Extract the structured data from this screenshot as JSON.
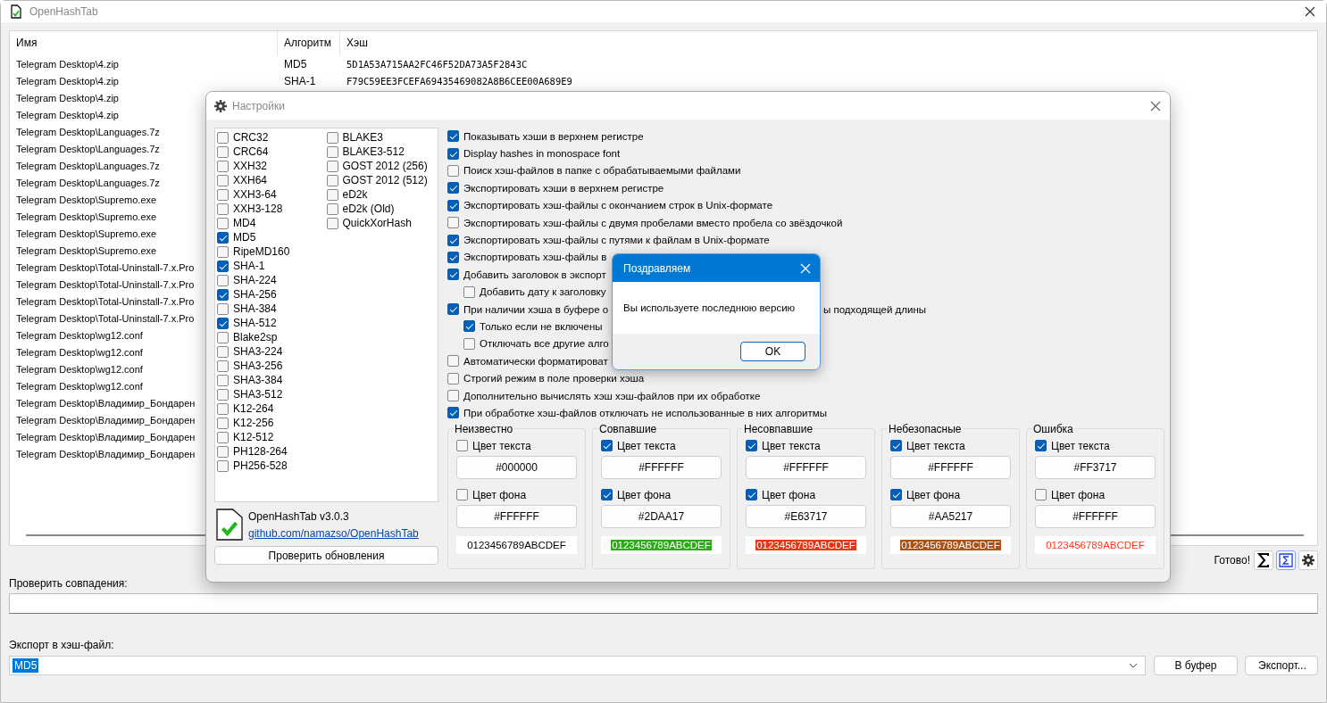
{
  "window": {
    "title": "OpenHashTab"
  },
  "table": {
    "columns": [
      "Имя",
      "Алгоритм",
      "Хэш"
    ],
    "rows": [
      {
        "name": "Telegram Desktop\\4.zip",
        "algorithm": "MD5",
        "hash": "5D1A53A715AA2FC46F52DA73A5F2843C"
      },
      {
        "name": "Telegram Desktop\\4.zip",
        "algorithm": "SHA-1",
        "hash": "F79C59EE3FCEFA69435469082A8B6CEE00A689E9"
      },
      {
        "name": "Telegram Desktop\\4.zip"
      },
      {
        "name": "Telegram Desktop\\4.zip"
      },
      {
        "name": "Telegram Desktop\\Languages.7z"
      },
      {
        "name": "Telegram Desktop\\Languages.7z"
      },
      {
        "name": "Telegram Desktop\\Languages.7z"
      },
      {
        "name": "Telegram Desktop\\Languages.7z"
      },
      {
        "name": "Telegram Desktop\\Supremo.exe"
      },
      {
        "name": "Telegram Desktop\\Supremo.exe"
      },
      {
        "name": "Telegram Desktop\\Supremo.exe"
      },
      {
        "name": "Telegram Desktop\\Supremo.exe"
      },
      {
        "name": "Telegram Desktop\\Total-Uninstall-7.x.Pro"
      },
      {
        "name": "Telegram Desktop\\Total-Uninstall-7.x.Pro"
      },
      {
        "name": "Telegram Desktop\\Total-Uninstall-7.x.Pro"
      },
      {
        "name": "Telegram Desktop\\Total-Uninstall-7.x.Pro"
      },
      {
        "name": "Telegram Desktop\\wg12.conf"
      },
      {
        "name": "Telegram Desktop\\wg12.conf"
      },
      {
        "name": "Telegram Desktop\\wg12.conf"
      },
      {
        "name": "Telegram Desktop\\wg12.conf"
      },
      {
        "name": "Telegram Desktop\\Владимир_Бондарен"
      },
      {
        "name": "Telegram Desktop\\Владимир_Бондарен"
      },
      {
        "name": "Telegram Desktop\\Владимир_Бондарен"
      },
      {
        "name": "Telegram Desktop\\Владимир_Бондарен"
      }
    ]
  },
  "status": "Готово!",
  "verify": {
    "label": "Проверить совпадения:"
  },
  "export": {
    "label": "Экспорт в хэш-файл:",
    "value": "MD5",
    "buttons": [
      "В буфер",
      "Экспорт..."
    ]
  },
  "settings": {
    "title": "Настройки",
    "algorithm_columns": [
      [
        {
          "label": "CRC32",
          "checked": false
        },
        {
          "label": "CRC64",
          "checked": false
        },
        {
          "label": "XXH32",
          "checked": false
        },
        {
          "label": "XXH64",
          "checked": false
        },
        {
          "label": "XXH3-64",
          "checked": false
        },
        {
          "label": "XXH3-128",
          "checked": false
        },
        {
          "label": "MD4",
          "checked": false
        },
        {
          "label": "MD5",
          "checked": true
        },
        {
          "label": "RipeMD160",
          "checked": false
        },
        {
          "label": "SHA-1",
          "checked": true
        },
        {
          "label": "SHA-224",
          "checked": false
        },
        {
          "label": "SHA-256",
          "checked": true
        },
        {
          "label": "SHA-384",
          "checked": false
        },
        {
          "label": "SHA-512",
          "checked": true
        },
        {
          "label": "Blake2sp",
          "checked": false
        },
        {
          "label": "SHA3-224",
          "checked": false
        },
        {
          "label": "SHA3-256",
          "checked": false
        },
        {
          "label": "SHA3-384",
          "checked": false
        },
        {
          "label": "SHA3-512",
          "checked": false
        },
        {
          "label": "K12-264",
          "checked": false
        },
        {
          "label": "K12-256",
          "checked": false
        },
        {
          "label": "K12-512",
          "checked": false
        },
        {
          "label": "PH128-264",
          "checked": false
        },
        {
          "label": "PH256-528",
          "checked": false
        }
      ],
      [
        {
          "label": "BLAKE3",
          "checked": false
        },
        {
          "label": "BLAKE3-512",
          "checked": false
        },
        {
          "label": "GOST 2012 (256)",
          "checked": false
        },
        {
          "label": "GOST 2012 (512)",
          "checked": false
        },
        {
          "label": "eD2k",
          "checked": false
        },
        {
          "label": "eD2k (Old)",
          "checked": false
        },
        {
          "label": "QuickXorHash",
          "checked": false
        }
      ]
    ],
    "about": {
      "name": "OpenHashTab v3.0.3",
      "link": "github.com/namazso/OpenHashTab"
    },
    "update_button": "Проверить обновления",
    "options": [
      {
        "label": "Показывать хэши в верхнем регистре",
        "checked": true
      },
      {
        "label": "Display hashes in monospace font",
        "checked": true
      },
      {
        "label": "Поиск хэш-файлов в папке с обрабатываемыми файлами",
        "checked": false
      },
      {
        "label": "Экспортировать хэши в верхнем регистре",
        "checked": true
      },
      {
        "label": "Экспортировать хэш-файлы с окончанием строк в Unix-формате",
        "checked": true
      },
      {
        "label": "Экспортировать хэш-файлы с двумя пробелами вместо пробела со звёздочкой",
        "checked": false
      },
      {
        "label": "Экспортировать хэш-файлы с путями к файлам в Unix-формате",
        "checked": true
      },
      {
        "label": "Экспортировать хэш-файлы в",
        "checked": true
      },
      {
        "label": "Добавить заголовок в экспорт",
        "checked": true,
        "children": [
          {
            "label": "Добавить дату к заголовку",
            "checked": false
          }
        ]
      },
      {
        "label": "При наличии хэша в буфере о",
        "tail": "ы подходящей длины",
        "checked": true,
        "children": [
          {
            "label": "Только если не включены",
            "checked": true
          },
          {
            "label": "Отключать все другие алго",
            "checked": false
          }
        ]
      },
      {
        "label": "Автоматически форматироват",
        "checked": false
      },
      {
        "label": "Строгий режим в поле проверки хэша",
        "checked": false
      },
      {
        "label": "Дополнительно вычислять хэш хэш-файлов при их обработке",
        "checked": false
      },
      {
        "label": "При обработке хэш-файлов отключать не использованные в них алгоритмы",
        "checked": true
      }
    ],
    "color_groups": [
      {
        "title": "Неизвестно",
        "text_color": {
          "label": "Цвет текста",
          "checked": false,
          "value": "#000000"
        },
        "background": {
          "label": "Цвет фона",
          "checked": false,
          "value": "#FFFFFF"
        },
        "sample": "0123456789ABCDEF"
      },
      {
        "title": "Совпавшие",
        "text_color": {
          "label": "Цвет текста",
          "checked": true,
          "value": "#FFFFFF"
        },
        "background": {
          "label": "Цвет фона",
          "checked": true,
          "value": "#2DAA17"
        },
        "sample": "0123456789ABCDEF"
      },
      {
        "title": "Несовпавшие",
        "text_color": {
          "label": "Цвет текста",
          "checked": true,
          "value": "#FFFFFF"
        },
        "background": {
          "label": "Цвет фона",
          "checked": true,
          "value": "#E63717"
        },
        "sample": "0123456789ABCDEF"
      },
      {
        "title": "Небезопасные",
        "text_color": {
          "label": "Цвет текста",
          "checked": true,
          "value": "#FFFFFF"
        },
        "background": {
          "label": "Цвет фона",
          "checked": true,
          "value": "#AA5217"
        },
        "sample": "0123456789ABCDEF"
      },
      {
        "title": "Ошибка",
        "text_color": {
          "label": "Цвет текста",
          "checked": true,
          "value": "#FF3717"
        },
        "background": {
          "label": "Цвет фона",
          "checked": false,
          "value": "#FFFFFF"
        },
        "sample": "0123456789ABCDEF"
      }
    ]
  },
  "dialog": {
    "title": "Поздравляем",
    "message": "Вы используете последнюю версию",
    "button": "OK"
  }
}
